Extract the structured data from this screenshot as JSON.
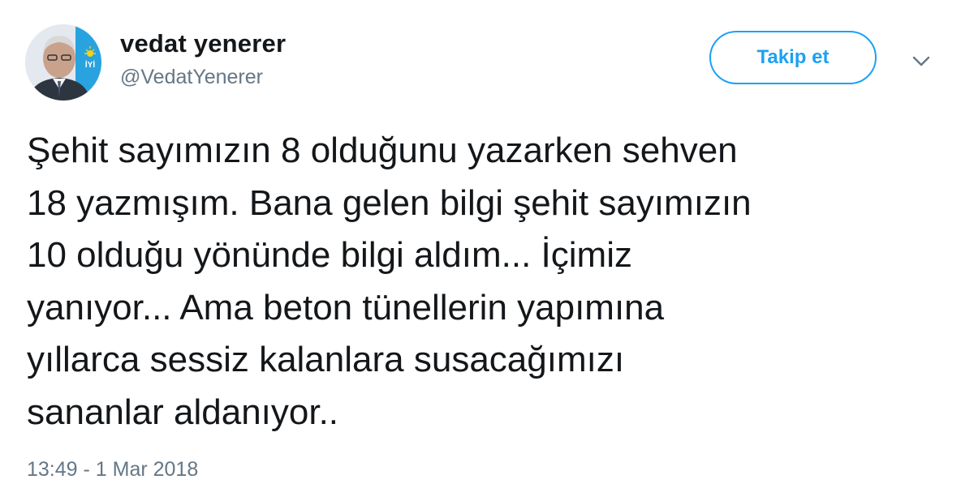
{
  "author": {
    "display_name": "vedat yenerer",
    "screen_name": "@VedatYenerer",
    "avatar_icon": "profile-photo-with-iyi-party-logo",
    "avatar_logo_text": "İYİ"
  },
  "actions": {
    "follow_label": "Takip et",
    "more_icon": "chevron-down-icon"
  },
  "tweet": {
    "lines": [
      "Şehit sayımızın 8 olduğunu yazarken sehven",
      "18 yazmışım. Bana gelen bilgi şehit sayımızın",
      "10 olduğu yönünde bilgi aldım... İçimiz",
      "yanıyor... Ama beton tünellerin yapımına",
      "yıllarca sessiz kalanlara susacağımızı",
      "sananlar aldanıyor.."
    ],
    "timestamp": "13:49 - 1 Mar 2018"
  },
  "colors": {
    "accent": "#1da1f2",
    "text": "#14171a",
    "secondary_text": "#657786"
  }
}
